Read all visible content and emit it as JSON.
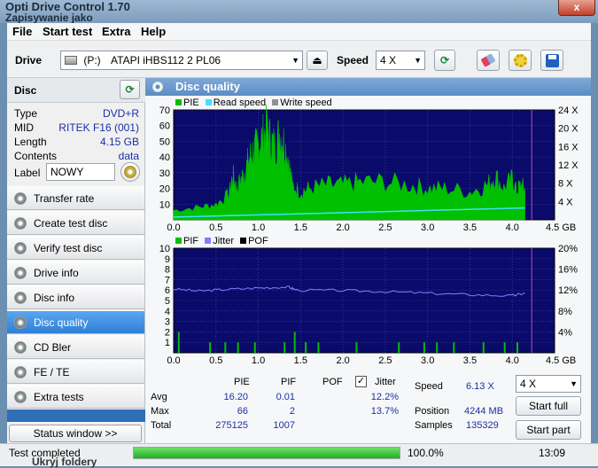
{
  "window": {
    "title": "Opti Drive Control 1.70",
    "subtitle": "Zapisywanie jako",
    "close_label": "x"
  },
  "menu": [
    "File",
    "Start test",
    "Extra",
    "Help"
  ],
  "toolbar": {
    "drive_label": "Drive",
    "drive_letter": "(P:)",
    "drive_name": "ATAPI iHBS112   2 PL06",
    "speed_label": "Speed",
    "speed_value": "4 X"
  },
  "disc": {
    "header": "Disc",
    "fields": [
      {
        "key": "Type",
        "value": "DVD+R"
      },
      {
        "key": "MID",
        "value": "RITEK F16 (001)"
      },
      {
        "key": "Length",
        "value": "4.15 GB"
      },
      {
        "key": "Contents",
        "value": "data"
      }
    ],
    "label_key": "Label",
    "label_value": "NOWY"
  },
  "nav": [
    {
      "label": "Transfer rate",
      "name": "transfer-rate"
    },
    {
      "label": "Create test disc",
      "name": "create-test-disc"
    },
    {
      "label": "Verify test disc",
      "name": "verify-test-disc"
    },
    {
      "label": "Drive info",
      "name": "drive-info"
    },
    {
      "label": "Disc info",
      "name": "disc-info"
    },
    {
      "label": "Disc quality",
      "name": "disc-quality"
    },
    {
      "label": "CD Bler",
      "name": "cd-bler"
    },
    {
      "label": "FE / TE",
      "name": "fe-te"
    },
    {
      "label": "Extra tests",
      "name": "extra-tests"
    }
  ],
  "active_nav": "disc-quality",
  "status_window_label": "Status window >>",
  "panel_title": "Disc quality",
  "chart_data": [
    {
      "type": "area",
      "legend": [
        "PIE",
        "Read speed",
        "Write speed"
      ],
      "colors": {
        "PIE": "#00c000",
        "Read speed": "#40e0ff",
        "Write speed": "#909090"
      },
      "x_ticks": [
        "0.0",
        "0.5",
        "1.0",
        "1.5",
        "2.0",
        "2.5",
        "3.0",
        "3.5",
        "4.0",
        "4.5 GB"
      ],
      "xlim": [
        0,
        4.5
      ],
      "y_ticks": [
        "10",
        "20",
        "30",
        "40",
        "50",
        "60",
        "70"
      ],
      "ylim": [
        0,
        70
      ],
      "y2_ticks": [
        "4 X",
        "8 X",
        "12 X",
        "16 X",
        "20 X",
        "24 X"
      ],
      "y2lim": [
        0,
        24
      ],
      "pie_profile": [
        [
          0,
          6
        ],
        [
          0.3,
          8
        ],
        [
          0.5,
          10
        ],
        [
          0.65,
          16
        ],
        [
          0.7,
          28
        ],
        [
          0.75,
          20
        ],
        [
          0.8,
          26
        ],
        [
          0.85,
          32
        ],
        [
          0.9,
          40
        ],
        [
          0.95,
          44
        ],
        [
          1.0,
          48
        ],
        [
          1.05,
          52
        ],
        [
          1.1,
          58
        ],
        [
          1.15,
          50
        ],
        [
          1.2,
          46
        ],
        [
          1.25,
          55
        ],
        [
          1.3,
          50
        ],
        [
          1.35,
          40
        ],
        [
          1.4,
          22
        ],
        [
          1.5,
          18
        ],
        [
          1.6,
          20
        ],
        [
          1.8,
          22
        ],
        [
          2.0,
          22
        ],
        [
          2.2,
          24
        ],
        [
          2.5,
          24
        ],
        [
          2.8,
          22
        ],
        [
          3.0,
          20
        ],
        [
          3.2,
          20
        ],
        [
          3.5,
          18
        ],
        [
          3.7,
          22
        ],
        [
          3.8,
          28
        ],
        [
          3.9,
          20
        ],
        [
          4.0,
          26
        ],
        [
          4.05,
          18
        ],
        [
          4.1,
          22
        ],
        [
          4.15,
          20
        ]
      ],
      "read_speed": [
        [
          0,
          0.6
        ],
        [
          4.15,
          2.6
        ]
      ],
      "end_marker_x": 4.23
    },
    {
      "type": "bar",
      "legend": [
        "PIF",
        "Jitter",
        "POF"
      ],
      "colors": {
        "PIF": "#00c000",
        "Jitter": "#8080ff",
        "POF": "#000000"
      },
      "x_ticks": [
        "0.0",
        "0.5",
        "1.0",
        "1.5",
        "2.0",
        "2.5",
        "3.0",
        "3.5",
        "4.0",
        "4.5 GB"
      ],
      "xlim": [
        0,
        4.5
      ],
      "y_ticks": [
        "1",
        "2",
        "3",
        "4",
        "5",
        "6",
        "7",
        "8",
        "9",
        "10"
      ],
      "ylim": [
        0,
        10
      ],
      "y2_ticks": [
        "4%",
        "8%",
        "12%",
        "16%",
        "20%"
      ],
      "y2lim": [
        0,
        20
      ],
      "pif_spikes": [
        [
          0.05,
          2
        ],
        [
          0.42,
          1
        ],
        [
          0.6,
          1
        ],
        [
          0.75,
          1
        ],
        [
          0.95,
          1
        ],
        [
          1.3,
          1
        ],
        [
          1.42,
          2
        ],
        [
          1.55,
          1
        ],
        [
          1.7,
          1
        ],
        [
          2.15,
          1
        ],
        [
          2.65,
          1
        ],
        [
          2.95,
          1
        ],
        [
          3.1,
          1
        ],
        [
          3.3,
          1
        ],
        [
          3.65,
          1
        ],
        [
          3.9,
          1
        ],
        [
          4.05,
          1
        ]
      ],
      "jitter": [
        [
          0,
          12.2
        ],
        [
          0.3,
          11.8
        ],
        [
          0.6,
          12.1
        ],
        [
          1.0,
          12.4
        ],
        [
          1.35,
          12.6
        ],
        [
          1.45,
          12.0
        ],
        [
          2.0,
          11.9
        ],
        [
          2.5,
          11.7
        ],
        [
          3.0,
          11.4
        ],
        [
          3.5,
          11.1
        ],
        [
          4.0,
          10.9
        ],
        [
          4.15,
          11.4
        ]
      ],
      "end_marker_x": 4.23
    }
  ],
  "stats": {
    "headers": [
      "PIE",
      "PIF",
      "POF"
    ],
    "jitter_label": "Jitter",
    "rows": [
      {
        "label": "Avg",
        "pie": "16.20",
        "pif": "0.01",
        "pof": "",
        "jitter": "12.2%"
      },
      {
        "label": "Max",
        "pie": "66",
        "pif": "2",
        "pof": "",
        "jitter": "13.7%"
      },
      {
        "label": "Total",
        "pie": "275125",
        "pif": "1007",
        "pof": "",
        "jitter": ""
      }
    ],
    "speed_label": "Speed",
    "speed_value": "6.13 X",
    "position_label": "Position",
    "position_value": "4244 MB",
    "samples_label": "Samples",
    "samples_value": "135329",
    "speed_select": "4 X",
    "start_full_label": "Start full",
    "start_part_label": "Start part"
  },
  "status": {
    "text": "Test completed",
    "progress_fraction": 1.0,
    "progress_text": "100.0%",
    "time": "13:09",
    "behind_text": "Ukryj foldery"
  }
}
